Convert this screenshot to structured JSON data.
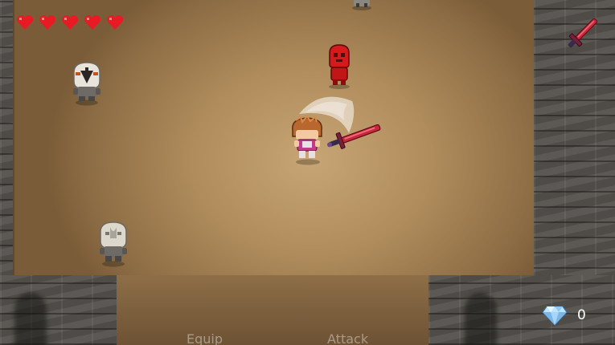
{
  "hud": {
    "hearts": {
      "filled": 5,
      "total": 5,
      "color": "#e81b24"
    },
    "equipped_weapon_icon": "sword-icon",
    "gem_icon": "diamond-icon",
    "gem_count": "0"
  },
  "controls": {
    "equip_label": "Equip",
    "attack_label": "Attack"
  },
  "scene": {
    "player": {
      "hair_color": "#b8672e",
      "shirt_color": "#c23a8a",
      "action": "sword-swing"
    },
    "enemies": [
      {
        "type": "skull-warrior-icon",
        "variant": "dark-mask"
      },
      {
        "type": "red-imp-icon",
        "color": "#d41a1a"
      },
      {
        "type": "skull-warrior-icon",
        "variant": "pale-mask"
      },
      {
        "type": "skull-warrior-icon",
        "variant": "partial"
      }
    ]
  },
  "colors": {
    "floor": "#b08c5c",
    "wall": "#53504b",
    "sword_blade": "#c8283a"
  }
}
